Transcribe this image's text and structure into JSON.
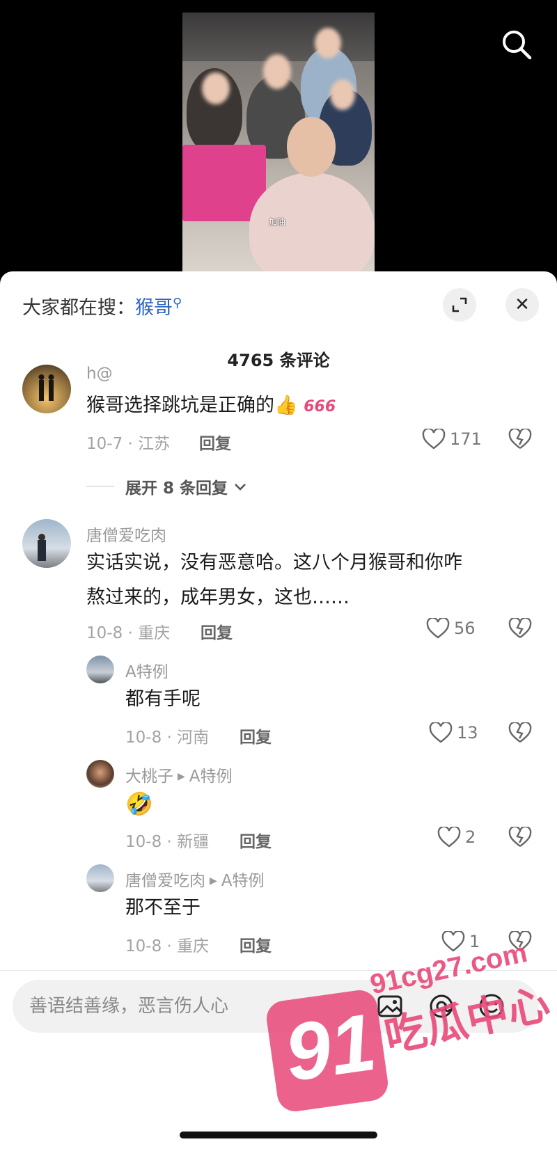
{
  "video": {
    "caption": "加油",
    "search_icon": "search-icon"
  },
  "sheet": {
    "search_hint_prefix": "大家都在搜：",
    "search_hint_keyword": "猴哥",
    "comment_count": "4765 条评论",
    "expand_icon": "expand-icon",
    "close_label": "✕"
  },
  "comments": [
    {
      "user": "h@",
      "text": "猴哥选择跳坑是正确的",
      "emoji": "👍",
      "sticker": "666",
      "date_location": "10-7 · 江苏",
      "reply_label": "回复",
      "likes": "171"
    },
    {
      "expand_replies": "展开 8 条回复"
    },
    {
      "user": "唐僧爱吃肉",
      "text_line1": "实话实说，没有恶意哈。这八个月猴哥和你咋",
      "text_line2": "熬过来的，成年男女，这也……",
      "date_location": "10-8 · 重庆",
      "reply_label": "回复",
      "likes": "56"
    }
  ],
  "replies": [
    {
      "user": "A特例",
      "text": "都有手呢",
      "date_location": "10-8 · 河南",
      "reply_label": "回复",
      "likes": "13"
    },
    {
      "user": "大桃子",
      "reply_to": "A特例",
      "text": "🤣",
      "date_location": "10-8 · 新疆",
      "reply_label": "回复",
      "likes": "2"
    },
    {
      "user": "唐僧爱吃肉",
      "reply_to": "A特例",
      "text": "那不至于",
      "date_location": "10-8 · 重庆",
      "reply_label": "回复",
      "likes": "1"
    }
  ],
  "input_bar": {
    "placeholder": "善语结善缘，恶言伤人心",
    "icons": [
      "image-icon",
      "mention-icon",
      "emoji-icon"
    ]
  },
  "watermark": {
    "number": "91",
    "site": "91cg27.com",
    "name": "吃瓜中心"
  }
}
